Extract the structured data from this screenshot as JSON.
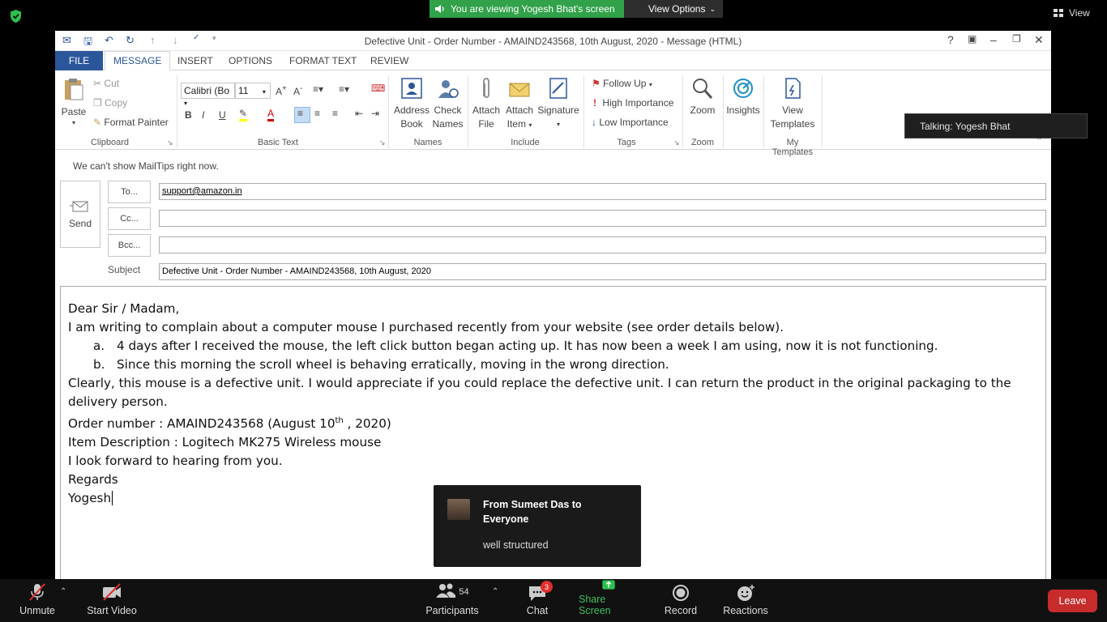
{
  "zoom": {
    "viewing_text": "You are viewing Yogesh Bhat's screen",
    "view_options": "View Options",
    "view_button": "View",
    "talking": "Talking: Yogesh Bhat",
    "chat_popup": {
      "from": "From Sumeet Das to Everyone",
      "message": "well structured"
    },
    "toolbar": {
      "unmute": "Unmute",
      "start_video": "Start Video",
      "participants": "Participants",
      "participants_count": "54",
      "chat": "Chat",
      "chat_badge": "3",
      "share_screen": "Share Screen",
      "record": "Record",
      "reactions": "Reactions",
      "leave": "Leave"
    }
  },
  "outlook": {
    "title": "Defective Unit - Order Number - AMAIND243568, 10th August, 2020 - Message (HTML)",
    "tabs": [
      "FILE",
      "MESSAGE",
      "INSERT",
      "OPTIONS",
      "FORMAT TEXT",
      "REVIEW"
    ],
    "ribbon": {
      "clipboard": {
        "paste": "Paste",
        "cut": "Cut",
        "copy": "Copy",
        "format_painter": "Format Painter",
        "label": "Clipboard"
      },
      "basic_text": {
        "font": "Calibri (Bo",
        "size": "11",
        "label": "Basic Text"
      },
      "names": {
        "address": "Address",
        "book": "Book",
        "check": "Check",
        "names": "Names",
        "label": "Names"
      },
      "include": {
        "attach": "Attach",
        "file": "File",
        "attach2": "Attach",
        "item": "Item",
        "signature": "Signature",
        "label": "Include"
      },
      "tags": {
        "follow_up": "Follow Up",
        "high": "High Importance",
        "low": "Low Importance",
        "label": "Tags"
      },
      "zoom": {
        "zoom": "Zoom",
        "label": "Zoom"
      },
      "insights": "Insights",
      "templates": {
        "view": "View",
        "templates": "Templates",
        "label": "My Templates"
      }
    },
    "mailtips": "We can't show MailTips right now.",
    "send": "Send",
    "to_label": "To...",
    "cc_label": "Cc...",
    "bcc_label": "Bcc...",
    "subject_label": "Subject",
    "to_value": "support@amazon.in",
    "cc_value": "",
    "bcc_value": "",
    "subject_value": "Defective Unit - Order Number - AMAIND243568, 10th August, 2020",
    "body": {
      "greeting": "Dear Sir / Madam,",
      "intro": "I am writing to complain about a computer mouse I purchased recently from your website (see order details below).",
      "item_a_marker": "a.",
      "item_a": "4 days after I received the mouse, the left click button began acting up. It has now been a week I am using, now it is not functioning.",
      "item_b_marker": "b.",
      "item_b": "Since this morning the scroll wheel is behaving erratically, moving in the wrong direction.",
      "para1": "Clearly, this mouse is a defective unit. I would appreciate if you could replace the defective unit. I can return the product in the original packaging to the",
      "para1_cont": "delivery person.",
      "order_prefix": "Order number : AMAIND243568 (August 10",
      "order_sup": "th",
      "order_suffix": " , 2020)",
      "item_desc": "Item Description : Logitech MK275 Wireless mouse",
      "closing": "I look forward to hearing from you.",
      "regards": "Regards",
      "name": "Yogesh"
    }
  }
}
